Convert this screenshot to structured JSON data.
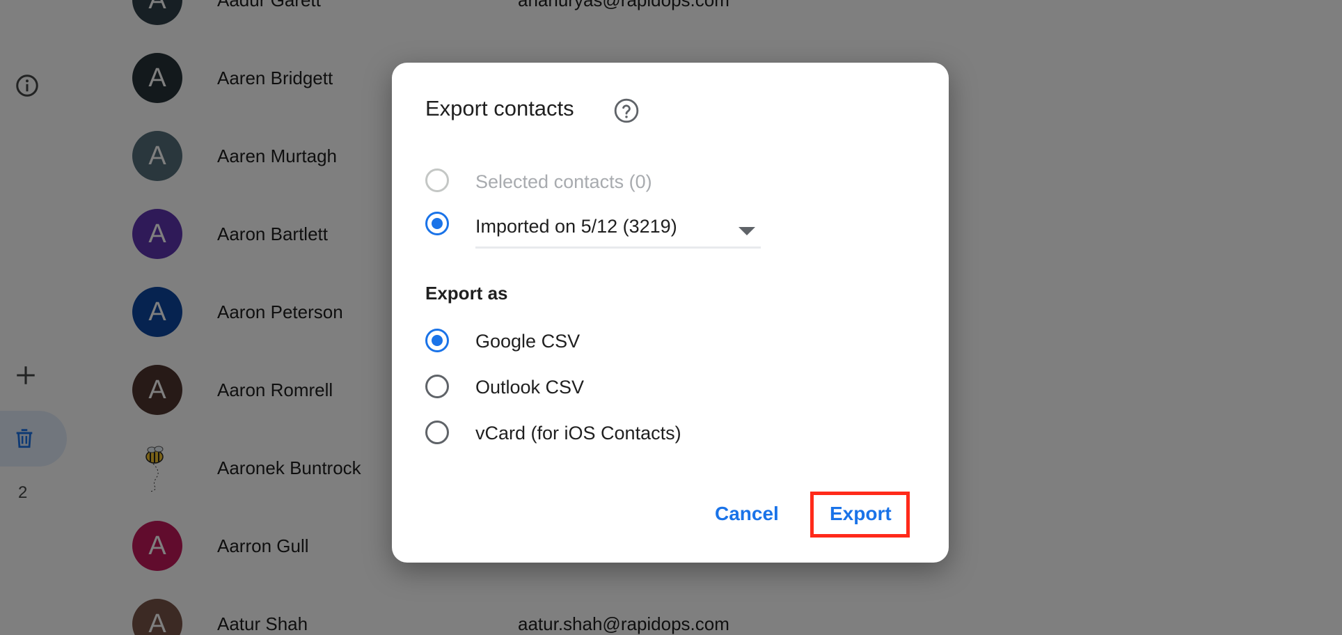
{
  "rail": {
    "icons": [
      "info-icon",
      "add-icon",
      "trash-icon"
    ],
    "trash_count": "2"
  },
  "contacts": [
    {
      "initial": "A",
      "name": "Aadur Garett",
      "email": "ananuryas@rapidops.com",
      "color": "#2f3e48"
    },
    {
      "initial": "A",
      "name": "Aaren Bridgett",
      "email": "",
      "color": "#263238"
    },
    {
      "initial": "A",
      "name": "Aaren Murtagh",
      "email": "",
      "color": "#546e7a"
    },
    {
      "initial": "A",
      "name": "Aaron Bartlett",
      "email": "",
      "color": "#5e35b1"
    },
    {
      "initial": "A",
      "name": "Aaron Peterson",
      "email": "",
      "color": "#0d47a1"
    },
    {
      "initial": "A",
      "name": "Aaron Romrell",
      "email": "",
      "color": "#4e342e"
    },
    {
      "initial": "",
      "name": "Aaronek Buntrock",
      "email": "",
      "color": "#ffffff",
      "photo": "bee-image"
    },
    {
      "initial": "A",
      "name": "Aarron Gull",
      "email": "",
      "color": "#c2185b"
    },
    {
      "initial": "A",
      "name": "Aatur Shah",
      "email": "aatur.shah@rapidops.com",
      "color": "#795548"
    }
  ],
  "dialog": {
    "title": "Export contacts",
    "help_icon": "help-circle-icon",
    "scope_options": [
      {
        "label": "Selected contacts (0)",
        "checked": false,
        "disabled": true
      },
      {
        "label": "Imported on 5/12 (3219)",
        "checked": true,
        "disabled": false
      }
    ],
    "export_as_heading": "Export as",
    "format_options": [
      {
        "label": "Google CSV",
        "checked": true
      },
      {
        "label": "Outlook CSV",
        "checked": false
      },
      {
        "label": "vCard (for iOS Contacts)",
        "checked": false
      }
    ],
    "cancel_label": "Cancel",
    "export_label": "Export"
  },
  "colors": {
    "accent": "#1a73e8",
    "highlight_box": "#ff2a1a"
  }
}
